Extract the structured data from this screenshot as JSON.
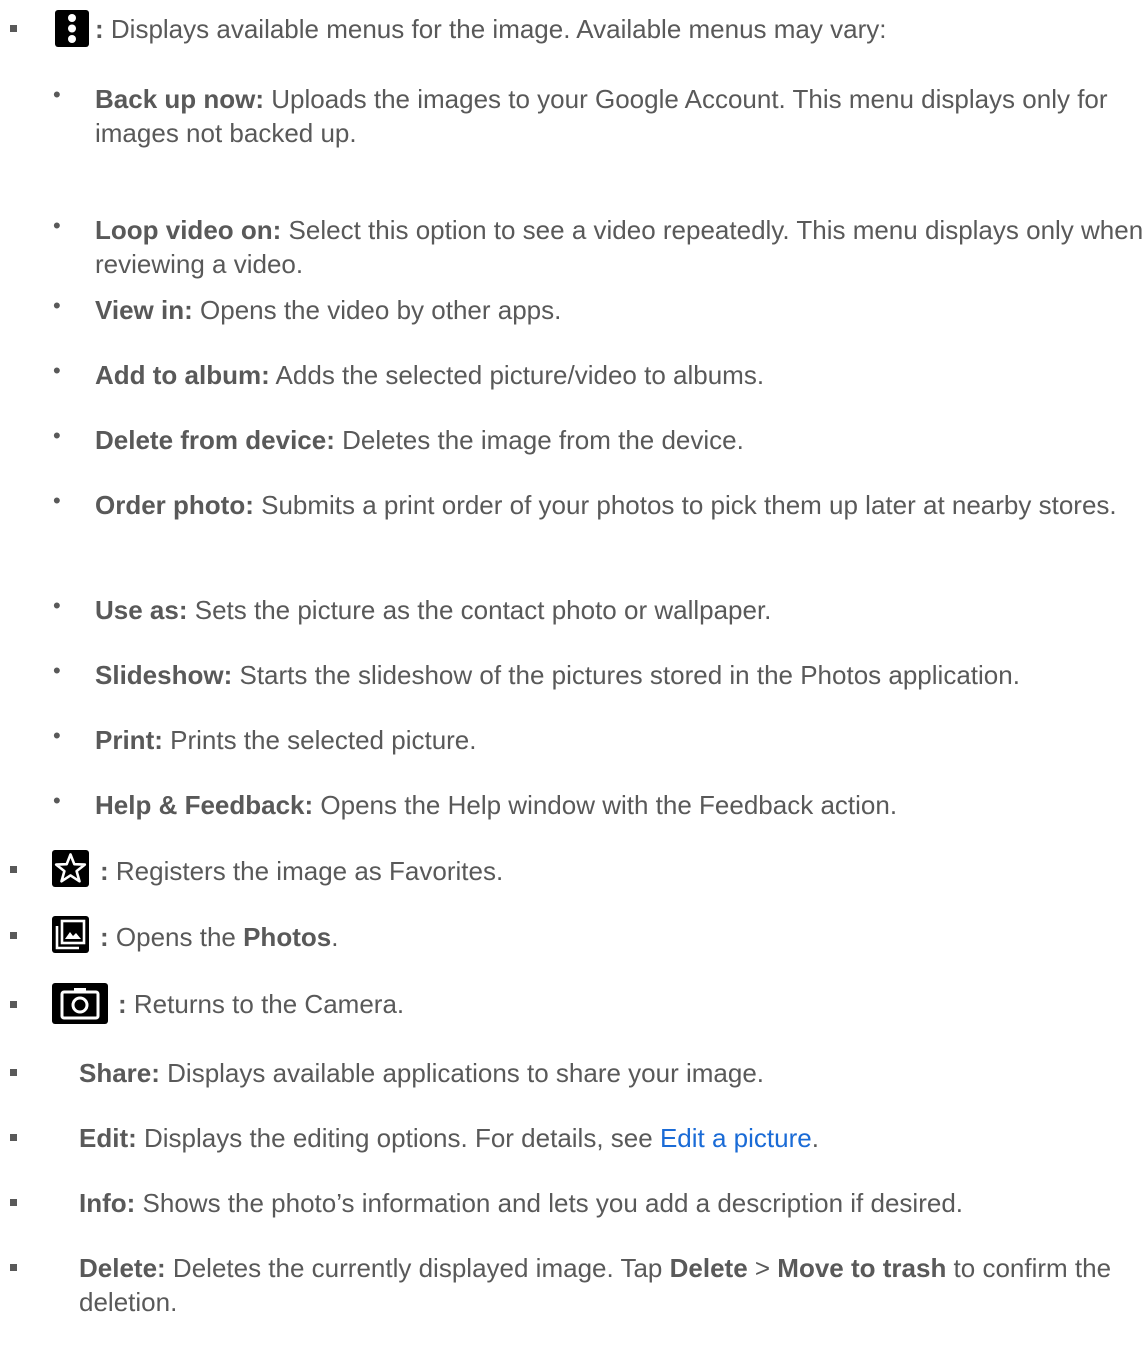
{
  "menu_item": {
    "icon": "more-vert-icon",
    "colon": ":",
    "desc": " Displays available menus for the image. Available menus may vary:"
  },
  "submenus": [
    {
      "bold": "Back up now:",
      "text": " Uploads the images to your Google Account. This menu displays only for images not backed up."
    },
    {
      "bold": "Loop video on:",
      "text": " Select this option to see a video repeatedly. This menu displays only when reviewing a video."
    },
    {
      "bold": "View in:",
      "text": " Opens the video by other apps."
    },
    {
      "bold": "Add to album:",
      "text": " Adds the selected picture/video to albums."
    },
    {
      "bold": "Delete from device:",
      "text": " Deletes the image from the device."
    },
    {
      "bold": "Order photo:",
      "text": " Submits a print order of your photos to pick them up later at nearby stores."
    },
    {
      "bold": "Use as:",
      "text": " Sets the picture as the contact photo or wallpaper."
    },
    {
      "bold": "Slideshow:",
      "text": " Starts the slideshow of the pictures stored in the Photos application."
    },
    {
      "bold": "Print:",
      "text": " Prints the selected picture."
    },
    {
      "bold": "Help & Feedback:",
      "text": " Opens the Help window with the Feedback action."
    }
  ],
  "favorites": {
    "icon": "star-outline-icon",
    "colon": ":",
    "desc": " Registers the image as Favorites."
  },
  "photos": {
    "icon": "photo-library-icon",
    "colon": ":",
    "desc_pre": " Opens the ",
    "desc_bold": "Photos",
    "desc_post": "."
  },
  "camera": {
    "icon": "camera-icon",
    "colon": ":",
    "desc": " Returns to the Camera."
  },
  "share": {
    "bold": "Share:",
    "text": " Displays available applications to share your image."
  },
  "edit": {
    "bold": "Edit:",
    "text_pre": " Displays the editing options. For details, see ",
    "link": "Edit a picture",
    "text_post": "."
  },
  "info": {
    "bold": "Info:",
    "text": " Shows the photo’s information and lets you add a description if desired."
  },
  "delete": {
    "bold": "Delete:",
    "text_pre": " Deletes the currently displayed image. Tap ",
    "bold2": "Delete",
    "sep": " > ",
    "bold3": "Move to trash",
    "text_post": " to confirm the deletion."
  },
  "colors": {
    "text": "#595959",
    "link": "#1a6bd6",
    "icon_bg": "#000000"
  }
}
